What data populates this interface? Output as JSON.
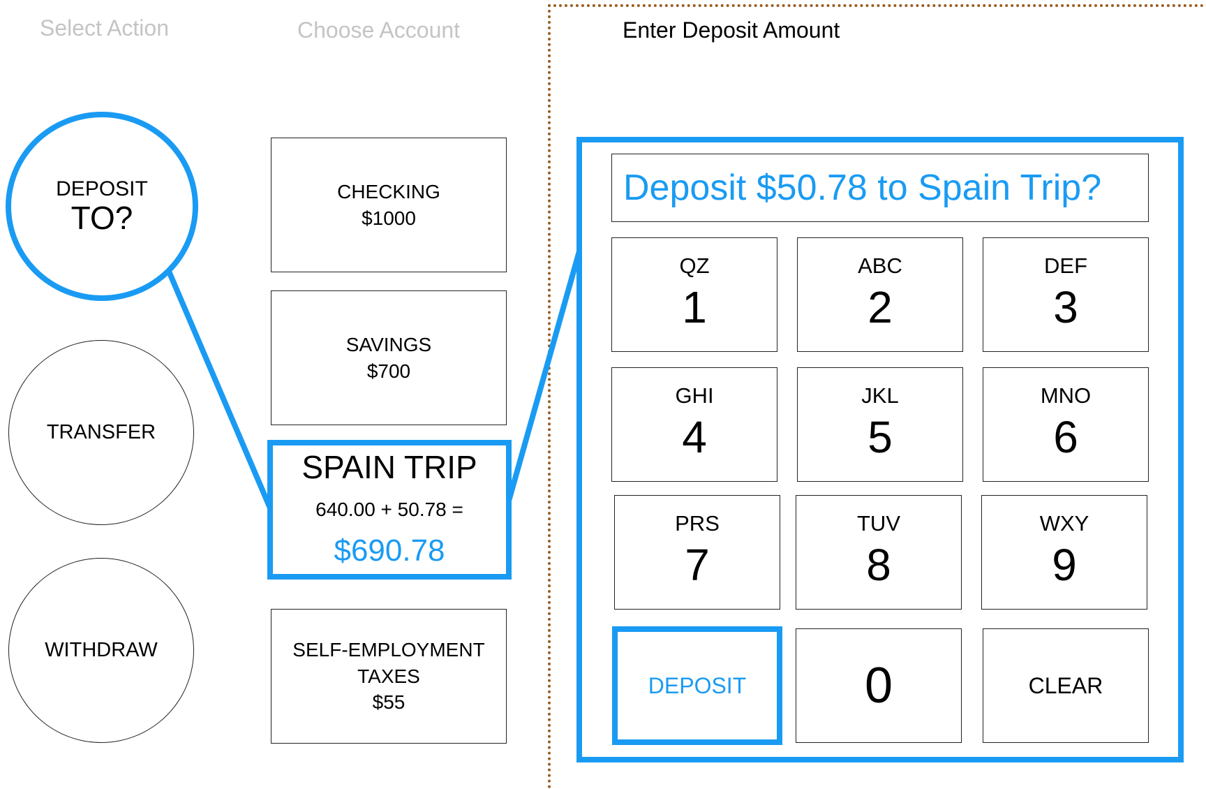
{
  "steps": {
    "select_action": "Select Action",
    "choose_account": "Choose Account",
    "enter_amount": "Enter Deposit Amount"
  },
  "actions": {
    "deposit": {
      "line1": "DEPOSIT",
      "line2": "TO?"
    },
    "transfer": "TRANSFER",
    "withdraw": "WITHDRAW"
  },
  "accounts": {
    "checking": {
      "name": "CHECKING",
      "balance": "$1000"
    },
    "savings": {
      "name": "SAVINGS",
      "balance": "$700"
    },
    "spain_trip": {
      "name": "SPAIN TRIP",
      "calc": "640.00 + 50.78 =",
      "total": "$690.78"
    },
    "self_employment": {
      "name_line1": "SELF-EMPLOYMENT",
      "name_line2": "TAXES",
      "balance": "$55"
    }
  },
  "confirm_text": "Deposit $50.78 to Spain Trip?",
  "keypad": {
    "k1": {
      "letters": "QZ",
      "digit": "1"
    },
    "k2": {
      "letters": "ABC",
      "digit": "2"
    },
    "k3": {
      "letters": "DEF",
      "digit": "3"
    },
    "k4": {
      "letters": "GHI",
      "digit": "4"
    },
    "k5": {
      "letters": "JKL",
      "digit": "5"
    },
    "k6": {
      "letters": "MNO",
      "digit": "6"
    },
    "k7": {
      "letters": "PRS",
      "digit": "7"
    },
    "k8": {
      "letters": "TUV",
      "digit": "8"
    },
    "k9": {
      "letters": "WXY",
      "digit": "9"
    },
    "k0": {
      "digit": "0"
    },
    "deposit": "DEPOSIT",
    "clear": "CLEAR"
  },
  "colors": {
    "accent": "#1a9bf3",
    "inactive_text": "#c4c4c4",
    "dotted_border": "#9a5c23"
  }
}
